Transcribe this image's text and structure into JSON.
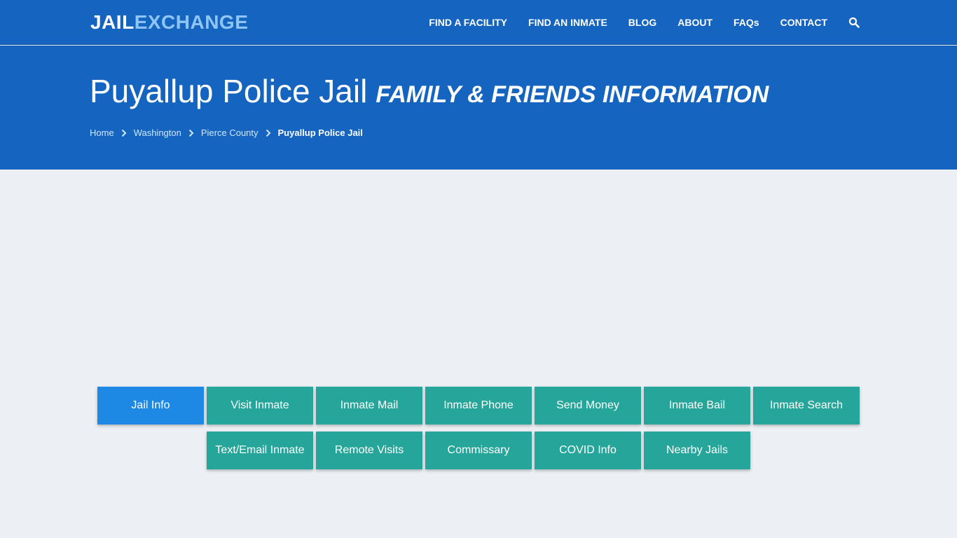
{
  "header": {
    "logo_part1": "JAIL",
    "logo_part2": "EXCHANGE",
    "nav": [
      {
        "label": "FIND A FACILITY"
      },
      {
        "label": "FIND AN INMATE"
      },
      {
        "label": "BLOG"
      },
      {
        "label": "ABOUT"
      },
      {
        "label": "FAQs"
      },
      {
        "label": "CONTACT"
      }
    ],
    "search_icon": "search-icon"
  },
  "hero": {
    "title": "Puyallup Police Jail",
    "subtitle": "FAMILY & FRIENDS INFORMATION",
    "breadcrumb": [
      {
        "label": "Home"
      },
      {
        "label": "Washington"
      },
      {
        "label": "Pierce County"
      },
      {
        "label": "Puyallup Police Jail"
      }
    ]
  },
  "tiles": {
    "row1": [
      {
        "label": "Jail Info",
        "active": true
      },
      {
        "label": "Visit Inmate"
      },
      {
        "label": "Inmate Mail"
      },
      {
        "label": "Inmate Phone"
      },
      {
        "label": "Send Money"
      },
      {
        "label": "Inmate Bail"
      },
      {
        "label": "Inmate Search"
      }
    ],
    "row2": [
      {
        "label": "Text/Email Inmate"
      },
      {
        "label": "Remote Visits"
      },
      {
        "label": "Commissary"
      },
      {
        "label": "COVID Info"
      },
      {
        "label": "Nearby Jails"
      }
    ]
  },
  "colors": {
    "header_blue": "#1565c0",
    "tile_teal": "#26a69a",
    "tile_active_blue": "#1e88e5",
    "page_bg": "#eceff3"
  }
}
